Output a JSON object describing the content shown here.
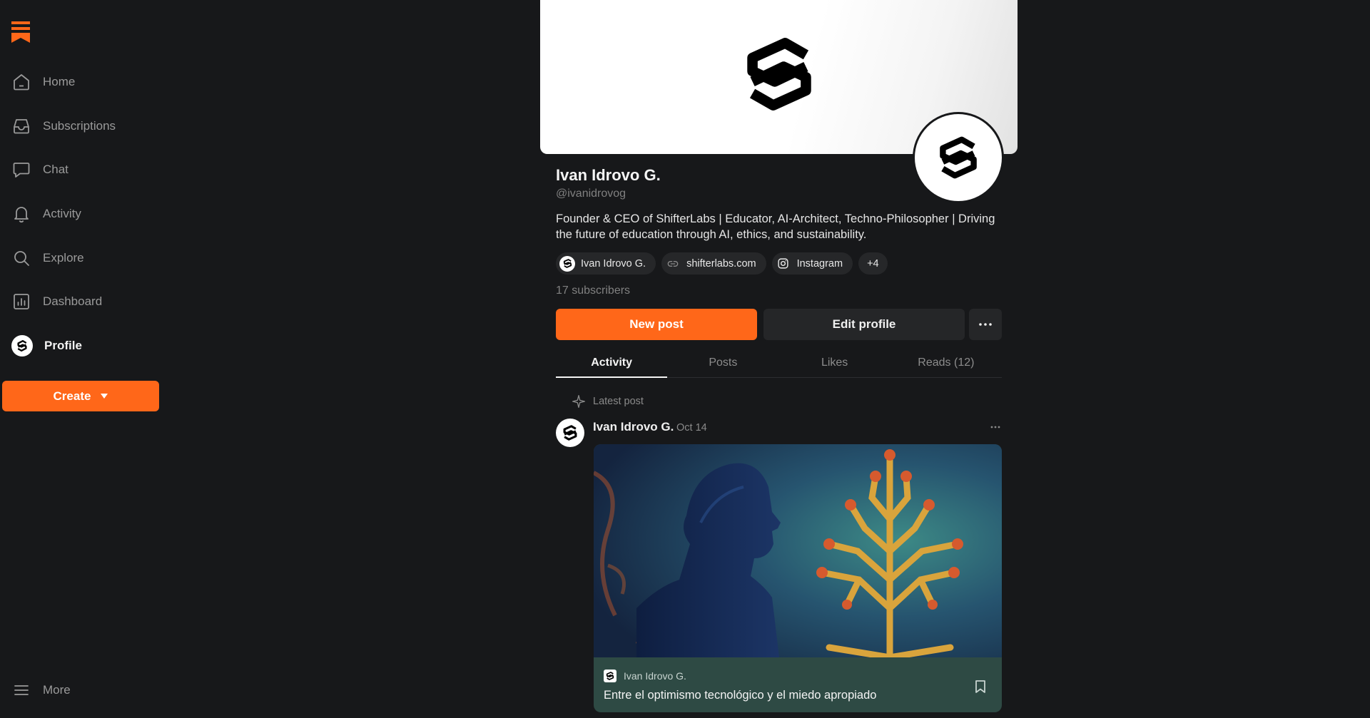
{
  "sidebar": {
    "items": [
      {
        "label": "Home",
        "icon": "home-icon"
      },
      {
        "label": "Subscriptions",
        "icon": "inbox-icon"
      },
      {
        "label": "Chat",
        "icon": "chat-icon"
      },
      {
        "label": "Activity",
        "icon": "bell-icon"
      },
      {
        "label": "Explore",
        "icon": "search-icon"
      },
      {
        "label": "Dashboard",
        "icon": "chart-icon"
      },
      {
        "label": "Profile",
        "icon": "profile-avatar"
      }
    ],
    "create_label": "Create",
    "more_label": "More"
  },
  "profile": {
    "name": "Ivan Idrovo G.",
    "handle": "@ivanidrovog",
    "bio": "Founder & CEO of ShifterLabs | Educator, AI-Architect, Techno-Philosopher | Driving the future of education through AI, ethics, and sustainability.",
    "chips": [
      {
        "label": "Ivan Idrovo G.",
        "icon": "publication-logo-icon"
      },
      {
        "label": "shifterlabs.com",
        "icon": "link-icon"
      },
      {
        "label": "Instagram",
        "icon": "instagram-icon"
      },
      {
        "label": "+4"
      }
    ],
    "subscribers": "17 subscribers",
    "new_post_label": "New post",
    "edit_profile_label": "Edit profile"
  },
  "tabs": [
    {
      "label": "Activity",
      "active": true
    },
    {
      "label": "Posts",
      "active": false
    },
    {
      "label": "Likes",
      "active": false
    },
    {
      "label": "Reads (12)",
      "active": false
    }
  ],
  "feed": {
    "section_label": "Latest post",
    "post": {
      "author": "Ivan Idrovo G.",
      "date": "Oct 14",
      "publication": "Ivan Idrovo G.",
      "title": "Entre el optimismo tecnológico y el miedo apropiado"
    }
  },
  "colors": {
    "accent": "#ff6719",
    "background": "#17181a",
    "card": "#2e4a44"
  }
}
